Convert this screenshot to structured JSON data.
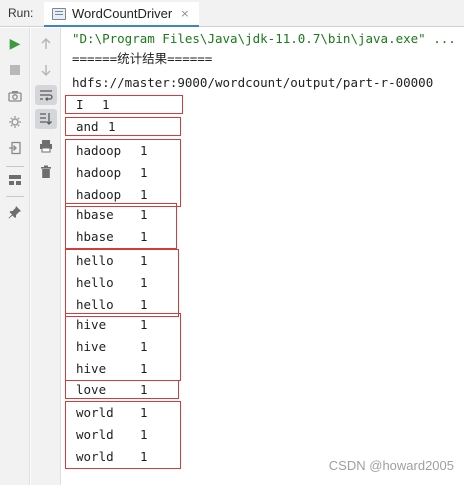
{
  "run_bar": {
    "label": "Run:",
    "tab_title": "WordCountDriver",
    "tab_close": "×"
  },
  "left_toolbar": {
    "icons": [
      "rerun-icon",
      "stop-icon",
      "camera-icon",
      "settings-icon",
      "exit-icon",
      "layout-icon",
      "pin-icon"
    ]
  },
  "right_toolbar": {
    "icons": [
      "up-arrow-icon",
      "down-arrow-icon",
      "soft-wrap-icon",
      "scroll-to-end-icon",
      "print-icon",
      "trash-icon"
    ]
  },
  "console": {
    "command_line": "\"D:\\Program Files\\Java\\jdk-11.0.7\\bin\\java.exe\" ...",
    "header_line": "======统计结果======",
    "path_line": "hdfs://master:9000/wordcount/output/part-r-00000",
    "groups": [
      {
        "rows": [
          {
            "word": "I",
            "count": "1"
          }
        ]
      },
      {
        "rows": [
          {
            "word": "and",
            "count": "1"
          }
        ]
      },
      {
        "rows": [
          {
            "word": "hadoop",
            "count": "1"
          },
          {
            "word": "hadoop",
            "count": "1"
          },
          {
            "word": "hadoop",
            "count": "1"
          }
        ]
      },
      {
        "rows": [
          {
            "word": "hbase",
            "count": "1"
          },
          {
            "word": "hbase",
            "count": "1"
          }
        ]
      },
      {
        "rows": [
          {
            "word": "hello",
            "count": "1"
          },
          {
            "word": "hello",
            "count": "1"
          },
          {
            "word": "hello",
            "count": "1"
          }
        ]
      },
      {
        "rows": [
          {
            "word": "hive",
            "count": "1"
          },
          {
            "word": "hive",
            "count": "1"
          },
          {
            "word": "hive",
            "count": "1"
          }
        ]
      },
      {
        "rows": [
          {
            "word": "love",
            "count": "1"
          }
        ]
      },
      {
        "rows": [
          {
            "word": "world",
            "count": "1"
          },
          {
            "word": "world",
            "count": "1"
          },
          {
            "word": "world",
            "count": "1"
          }
        ]
      }
    ]
  },
  "watermark": "CSDN @howard2005",
  "colors": {
    "highlight_box": "#d63a3a",
    "run_green": "#3d9a3d",
    "tab_underline": "#4083c9"
  }
}
